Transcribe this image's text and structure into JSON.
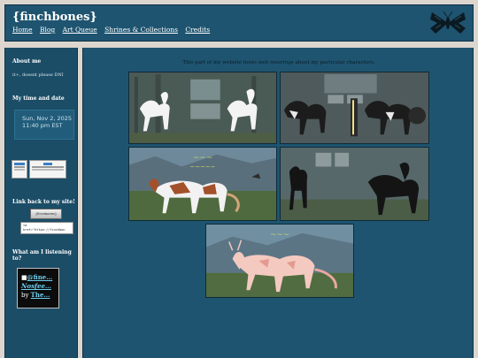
{
  "header": {
    "title": "{finchbones}",
    "nav": [
      "Home",
      "Blog",
      "Art Queue",
      "Shrines & Collections",
      "Credits"
    ],
    "logo_icon": "moth-icon"
  },
  "sidebar": {
    "about_heading": "About me",
    "about_text": "it+, doesnt please DNI",
    "time_heading": "My time and date",
    "clock_date": "Sun, Nov 2, 2025",
    "clock_time": "11:40 pm EST",
    "link_heading": "Link back to my site!",
    "link_button_text": "{finchbones}",
    "code_snippet": "<a href=\"https://finchbon",
    "listening_heading": "What am I listening to?",
    "np_track_1": "@fine…",
    "np_track_2": "Nosfee…",
    "np_by": "by",
    "np_artist": "The…"
  },
  "main": {
    "intro_before": "This part of my website hosts",
    "intro_em": "web moorings",
    "intro_after": "about my particular characters."
  },
  "colors": {
    "page_bg": "#dcd6cf",
    "panel": "#1e5470",
    "accent_link": "#6fd0f0"
  }
}
